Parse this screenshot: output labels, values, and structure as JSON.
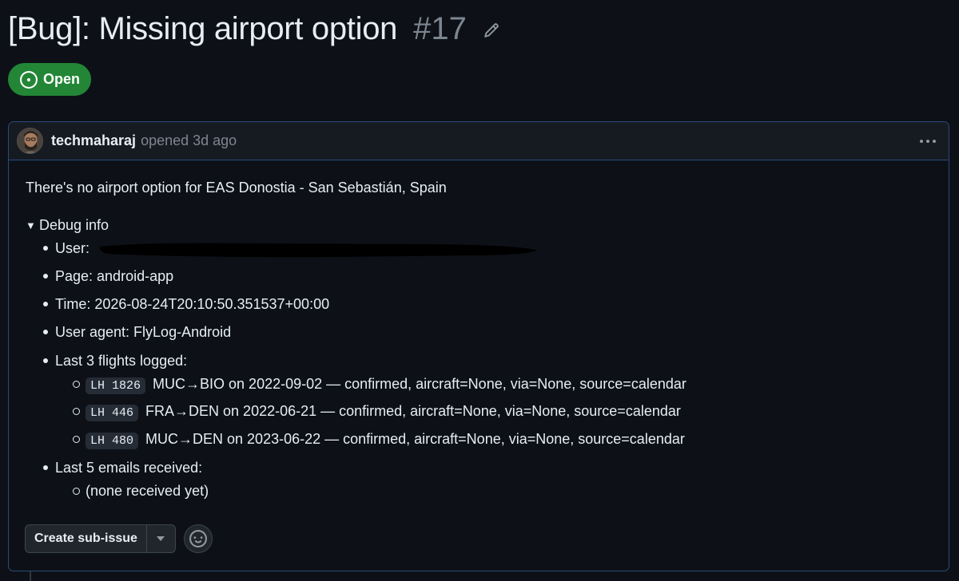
{
  "issue": {
    "title": "[Bug]: Missing airport option",
    "number": "#17",
    "status": "Open",
    "status_color": "#238636"
  },
  "comment": {
    "author": "techmaharaj",
    "meta": "opened 3d ago",
    "intro": "There's no airport option for EAS Donostia - San Sebastián, Spain",
    "details_summary": "Debug info",
    "user_label": "User:",
    "page": "Page: android-app",
    "time": "Time: 2026-08-24T20:10:50.351537+00:00",
    "user_agent": "User agent: FlyLog-Android",
    "flights_label": "Last 3 flights logged:",
    "flights": [
      {
        "code": "LH 1826",
        "text": "MUC→BIO on 2022-09-02 — confirmed, aircraft=None, via=None, source=calendar"
      },
      {
        "code": "LH 446",
        "text": "FRA→DEN on 2022-06-21 — confirmed, aircraft=None, via=None, source=calendar"
      },
      {
        "code": "LH 480",
        "text": "MUC→DEN on 2023-06-22 — confirmed, aircraft=None, via=None, source=calendar"
      }
    ],
    "emails_label": "Last 5 emails received:",
    "emails": [
      "(none received yet)"
    ]
  },
  "actions": {
    "create_sub_issue": "Create sub-issue"
  },
  "icons": {
    "edit": "pencil-icon",
    "status": "issue-opened-icon",
    "menu": "kebab-horizontal-icon",
    "caret": "triangle-down-icon",
    "reaction": "smiley-icon"
  },
  "colors": {
    "background": "#0d1117",
    "border_accent": "#2b4a79",
    "muted_text": "#7d8590"
  }
}
